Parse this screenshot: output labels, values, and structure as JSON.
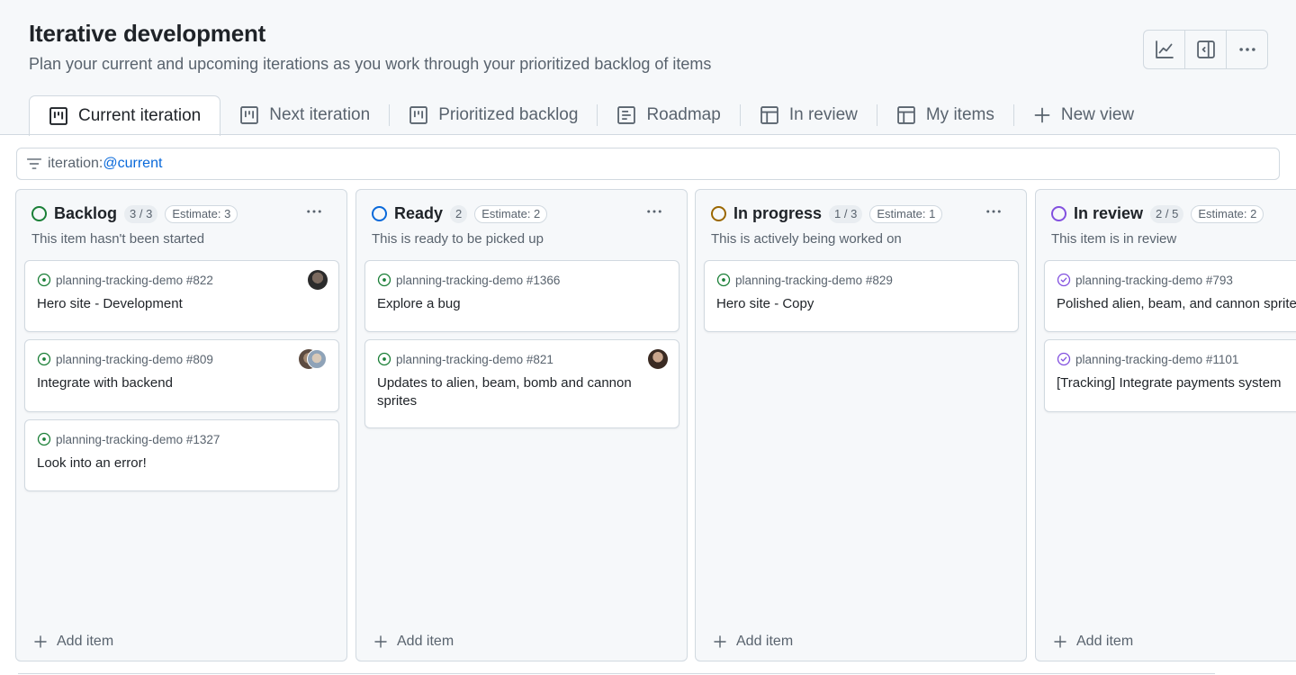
{
  "project": {
    "title": "Iterative development",
    "subtitle": "Plan your current and upcoming iterations as you work through your prioritized backlog of items"
  },
  "actions": [
    {
      "icon": "insights-graph-icon"
    },
    {
      "icon": "side-panel-icon"
    },
    {
      "icon": "more-horizontal-icon"
    }
  ],
  "tabs": [
    {
      "label": "Current iteration",
      "icon": "board-icon",
      "active": true
    },
    {
      "label": "Next iteration",
      "icon": "board-icon"
    },
    {
      "label": "Prioritized backlog",
      "icon": "board-icon"
    },
    {
      "label": "Roadmap",
      "icon": "roadmap-icon"
    },
    {
      "label": "In review",
      "icon": "table-icon"
    },
    {
      "label": "My items",
      "icon": "table-icon"
    },
    {
      "label": "New view",
      "icon": "plus-icon"
    }
  ],
  "filter": {
    "key": "iteration:",
    "value": "@current"
  },
  "columns": [
    {
      "name": "Backlog",
      "count": "3 / 3",
      "estimate": "Estimate: 3",
      "description": "This item hasn't been started",
      "status_color": "#1a7f37",
      "add_label": "Add item",
      "cards": [
        {
          "repo": "planning-tracking-demo #822",
          "title": "Hero site - Development",
          "state": "open"
        },
        {
          "repo": "planning-tracking-demo #809",
          "title": "Integrate with backend",
          "state": "open"
        },
        {
          "repo": "planning-tracking-demo #1327",
          "title": "Look into an error!",
          "state": "open"
        }
      ]
    },
    {
      "name": "Ready",
      "count": "2",
      "estimate": "Estimate: 2",
      "description": "This is ready to be picked up",
      "status_color": "#0969da",
      "add_label": "Add item",
      "cards": [
        {
          "repo": "planning-tracking-demo #1366",
          "title": "Explore a bug",
          "state": "open"
        },
        {
          "repo": "planning-tracking-demo #821",
          "title": "Updates to alien, beam, bomb and cannon sprites",
          "state": "open"
        }
      ]
    },
    {
      "name": "In progress",
      "count": "1 / 3",
      "estimate": "Estimate: 1",
      "description": "This is actively being worked on",
      "status_color": "#9a6700",
      "add_label": "Add item",
      "cards": [
        {
          "repo": "planning-tracking-demo #829",
          "title": "Hero site - Copy",
          "state": "open"
        }
      ]
    },
    {
      "name": "In review",
      "count": "2 / 5",
      "estimate": "Estimate: 2",
      "description": "This item is in review",
      "status_color": "#8250df",
      "add_label": "Add item",
      "cards": [
        {
          "repo": "planning-tracking-demo #793",
          "title": "Polished alien, beam, and cannon sprites",
          "state": "done"
        },
        {
          "repo": "planning-tracking-demo #1101",
          "title": "[Tracking] Integrate payments system",
          "state": "done"
        }
      ]
    }
  ]
}
